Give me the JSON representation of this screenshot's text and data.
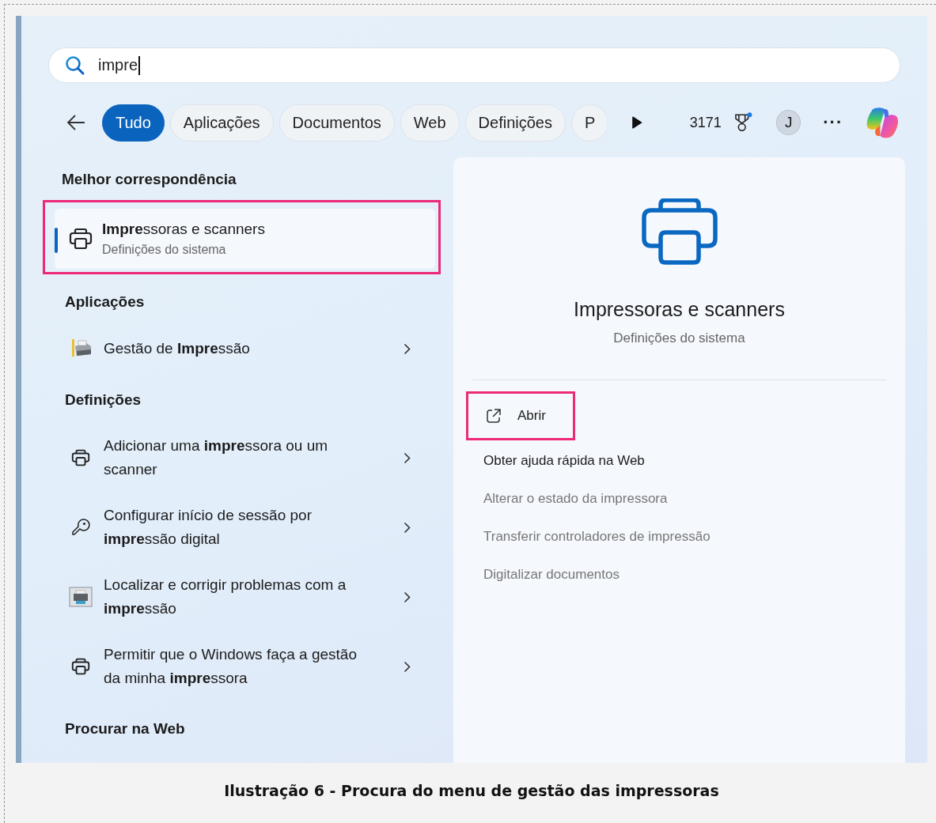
{
  "search": {
    "value": "impre"
  },
  "filters": [
    {
      "label": "Tudo",
      "selected": true
    },
    {
      "label": "Aplicações",
      "selected": false
    },
    {
      "label": "Documentos",
      "selected": false
    },
    {
      "label": "Web",
      "selected": false
    },
    {
      "label": "Definições",
      "selected": false
    },
    {
      "label": "P",
      "selected": false
    }
  ],
  "points": "3171",
  "avatar": "J",
  "more": "···",
  "sections": [
    {
      "heading": "Melhor correspondência",
      "kind": "best",
      "items": [
        {
          "title": "**Impre**ssoras e scanners",
          "subtitle": "Definições do sistema",
          "selected": true,
          "annotated": true
        }
      ]
    },
    {
      "heading": "Aplicações",
      "kind": "list",
      "items": [
        {
          "kind": "app",
          "title": "Gestão de **Impre**ssão"
        }
      ]
    },
    {
      "heading": "Definições",
      "kind": "list",
      "items": [
        {
          "kind": "printer",
          "title": "Adicionar uma **impre**ssora ou um scanner"
        },
        {
          "kind": "key",
          "title": "Configurar início de sessão por **impre**ssão digital"
        },
        {
          "kind": "troubleshoot",
          "title": "Localizar e corrigir problemas com a **impre**ssão"
        },
        {
          "kind": "printer",
          "title": "Permitir que o Windows faça a gestão da minha **impre**ssora"
        }
      ]
    },
    {
      "heading": "Procurar na Web"
    }
  ],
  "detail": {
    "title": "Impressoras e scanners",
    "subtitle": "Definições do sistema",
    "actions": [
      {
        "label": "Abrir",
        "kind": "open",
        "disabled": false,
        "annotated": true
      },
      {
        "label": "Obter ajuda rápida na Web",
        "kind": "link",
        "disabled": false,
        "annotated": false
      },
      {
        "label": "Alterar o estado da impressora",
        "kind": "link",
        "disabled": true,
        "annotated": false
      },
      {
        "label": "Transferir controladores de impressão",
        "kind": "link",
        "disabled": true,
        "annotated": false
      },
      {
        "label": "Digitalizar documentos",
        "kind": "link",
        "disabled": true,
        "annotated": false
      }
    ]
  },
  "caption": "Ilustração 6 - Procura do menu de gestão das impressoras"
}
